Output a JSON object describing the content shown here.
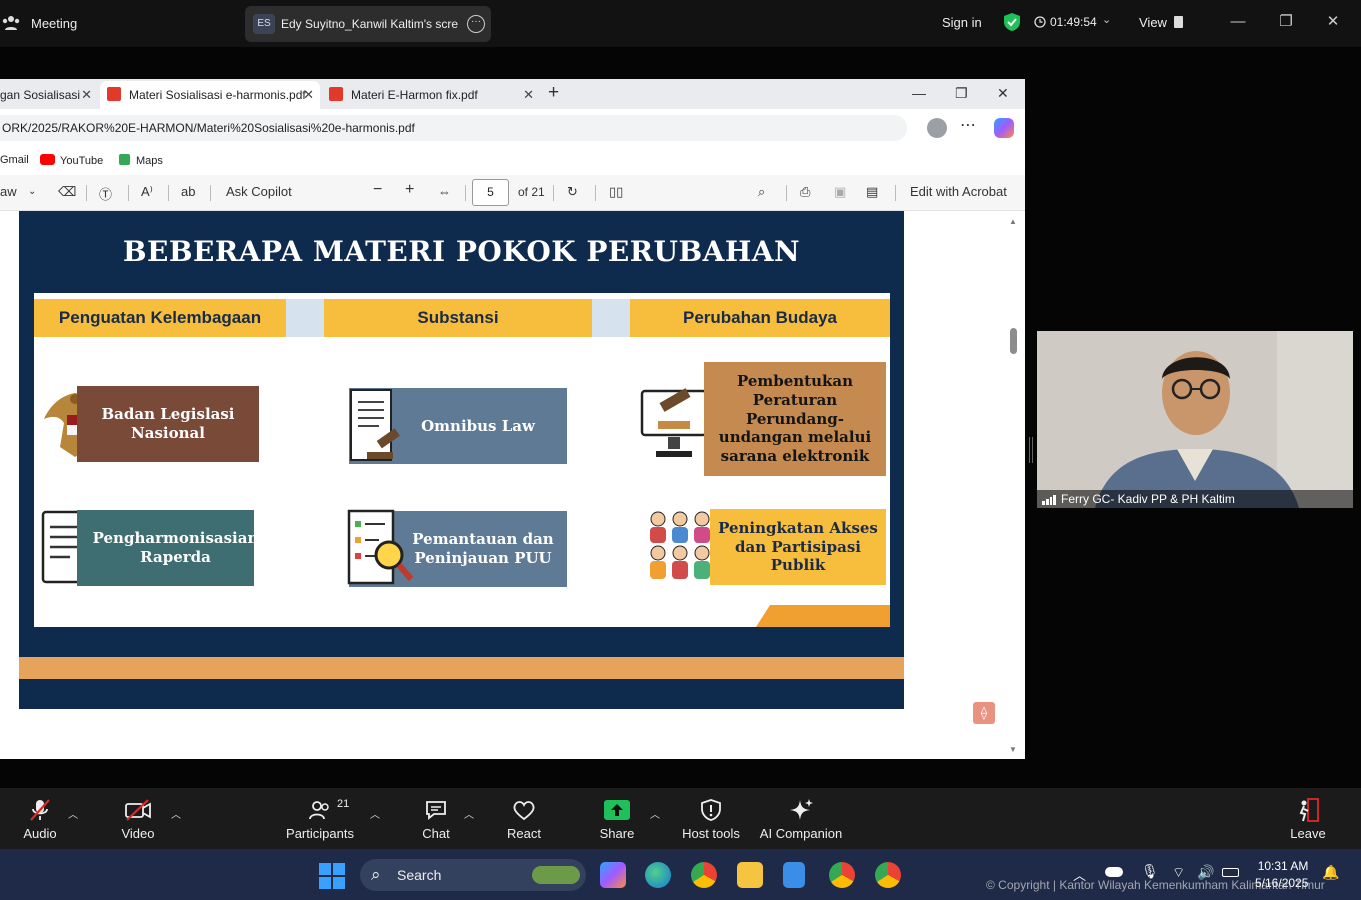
{
  "zoom": {
    "meeting_label": "Meeting",
    "share": {
      "initials": "ES",
      "title": "Edy Suyitno_Kanwil Kaltim's scre"
    },
    "sign_in": "Sign in",
    "timer": "01:49:54",
    "view_label": "View"
  },
  "browser": {
    "tabs": [
      {
        "label": "gan Sosialisasi"
      },
      {
        "label": "Materi Sosialisasi e-harmonis.pdf"
      },
      {
        "label": "Materi E-Harmon fix.pdf"
      }
    ],
    "address": "ORK/2025/RAKOR%20E-HARMON/Materi%20Sosialisasi%20e-harmonis.pdf",
    "bookmarks": [
      "Gmail",
      "YouTube",
      "Maps"
    ]
  },
  "pdf_toolbar": {
    "draw_label": "aw",
    "ask_copilot": "Ask Copilot",
    "page_current": "5",
    "page_total": "of 21",
    "edit_acrobat": "Edit with Acrobat"
  },
  "slide": {
    "title": "BEBERAPA MATERI POKOK PERUBAHAN",
    "columns": [
      "Penguatan Kelembagaan",
      "Substansi",
      "Perubahan Budaya"
    ],
    "items": [
      "Badan Legislasi Nasional",
      "Omnibus Law",
      "Pembentukan Peraturan Perundang-undangan melalui sarana elektronik",
      "Pengharmonisasian Raperda",
      "Pemantauan dan Peninjauan PUU",
      "Peningkatan Akses dan Partisipasi Publik"
    ]
  },
  "participant": {
    "name": "Ferry GC- Kadiv PP & PH Kaltim"
  },
  "toolbar": {
    "audio": "Audio",
    "video": "Video",
    "participants": "Participants",
    "participants_count": "21",
    "chat": "Chat",
    "react": "React",
    "share": "Share",
    "host_tools": "Host tools",
    "ai_companion": "AI Companion",
    "leave": "Leave"
  },
  "taskbar": {
    "search": "Search",
    "time": "10:31 AM",
    "date": "5/16/2025"
  },
  "watermark": "© Copyright | Kantor Wilayah Kemenkumham Kalimantan Timur"
}
